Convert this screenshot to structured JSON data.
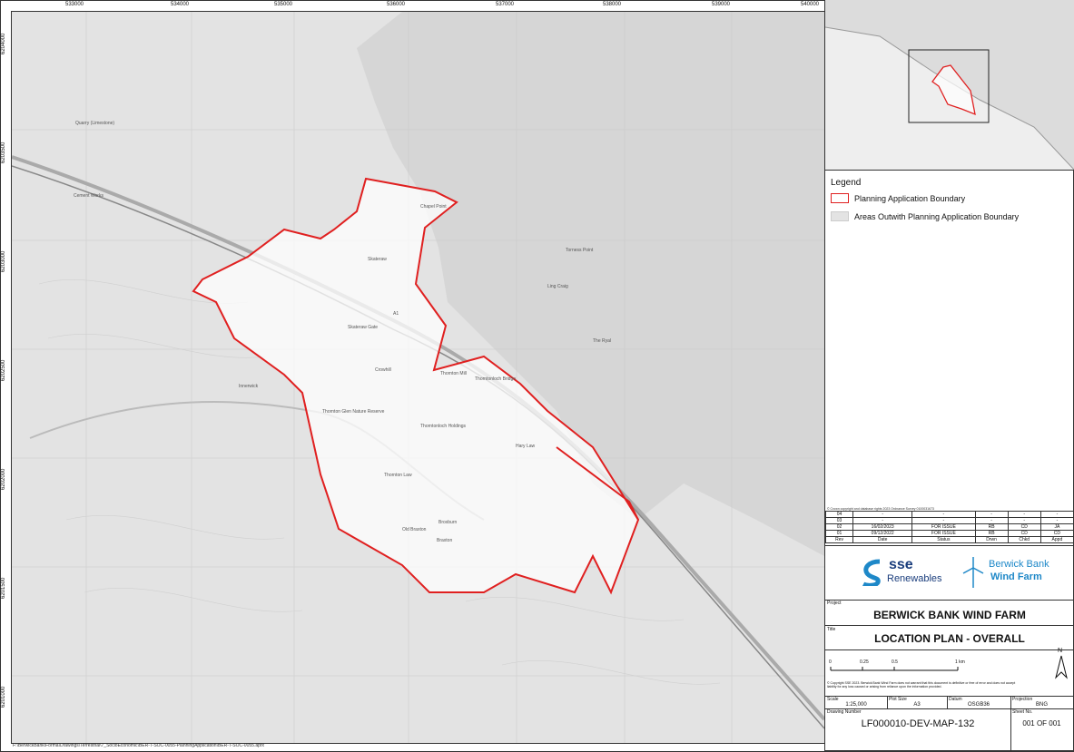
{
  "map": {
    "eastings": [
      "533000",
      "534000",
      "535000",
      "536000",
      "537000",
      "538000",
      "539000",
      "540000"
    ],
    "northings": [
      "6201000",
      "6201500",
      "6202000",
      "6202500",
      "6203000",
      "6203500",
      "6204000",
      "6204500"
    ],
    "place_labels": [
      "Skateraw",
      "Chapel Point",
      "Skateraw Gate",
      "Crowhill",
      "Thornton Mill",
      "Thorntonloch Bridge",
      "Thornton Glen Nature Reserve",
      "Thorntonloch Holdings",
      "Hary Law",
      "Thornton Law",
      "Braxton",
      "Old Braxton",
      "Ling Craig",
      "Torness Point",
      "The Ryal",
      "Innerwick",
      "Quarry (Limestone)",
      "Cement Works",
      "Broxburn"
    ],
    "road_label": "A1",
    "file_path": "F:\\BerwickBank\\Forma\\Drawings\\Terrestrial\\7_SocioEconomic\\BER-T-SOC-0055-PlanningApplication\\BER-T-SOC-0055.aprx"
  },
  "legend": {
    "title": "Legend",
    "items": [
      {
        "label": "Planning Application Boundary",
        "color": "#e02020"
      },
      {
        "label": "Areas Outwith Planning Application Boundary",
        "color": "#e3e3e3"
      }
    ]
  },
  "copyright_small": "© Crown copyright and database rights 2023 Ordnance Survey 0100031673",
  "revisions": {
    "rows": [
      [
        "04",
        "-",
        "-",
        "-",
        "-",
        "-"
      ],
      [
        "03",
        "-",
        "-",
        "-",
        "-",
        "-"
      ],
      [
        "02",
        "16/02/2023",
        "FOR ISSUE",
        "RB",
        "CD",
        "JA"
      ],
      [
        "01",
        "09/12/2022",
        "FOR ISSUE",
        "RB",
        "CD",
        "CD"
      ]
    ],
    "header": [
      "Rev",
      "Date",
      "Status",
      "Drwn",
      "Chkd",
      "Appd"
    ]
  },
  "logos": {
    "sse_top": "sse",
    "sse_bottom": "Renewables",
    "bb_top": "Berwick Bank",
    "bb_bottom": "Wind Farm"
  },
  "project": {
    "label": "Project",
    "value": "BERWICK BANK WIND FARM"
  },
  "title": {
    "label": "Title",
    "value": "LOCATION PLAN - OVERALL"
  },
  "scalebar": {
    "ticks": [
      "0",
      "0.25",
      "0.5",
      "1 km"
    ],
    "north": "N",
    "disclaimer": "© Copyright SSE 2023. Berwick Bank Wind Farm does not warrant that this document is definitive or free of error and does not accept liability for any loss caused or arising from reliance upon the information provided."
  },
  "titleblock": {
    "scale_label": "Scale",
    "scale": "1:25,000",
    "plot_label": "Plot Size",
    "plot": "A3",
    "datum_label": "Datum",
    "datum": "OSGB36",
    "proj_label": "Projection",
    "proj": "BNG",
    "drawing_label": "Drawing Number",
    "drawing": "LF000010-DEV-MAP-132",
    "sheet_label": "Sheet No.",
    "sheet": "001 OF 001"
  }
}
